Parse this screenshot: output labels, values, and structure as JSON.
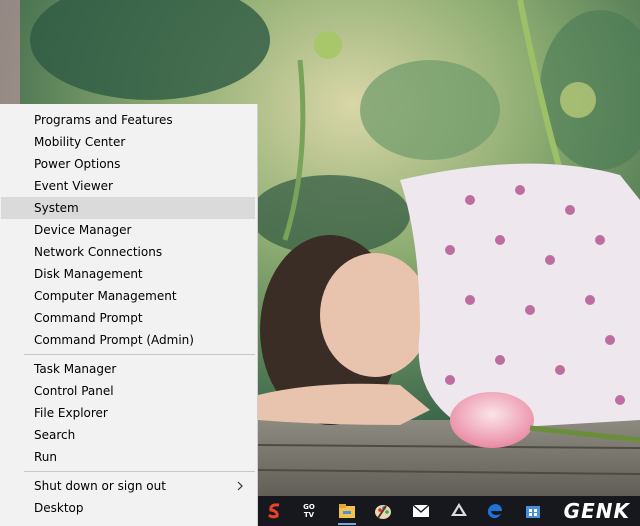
{
  "menu": {
    "items": [
      {
        "label": "Programs and Features"
      },
      {
        "label": "Mobility Center"
      },
      {
        "label": "Power Options"
      },
      {
        "label": "Event Viewer"
      },
      {
        "label": "System",
        "hovered": true
      },
      {
        "label": "Device Manager"
      },
      {
        "label": "Network Connections"
      },
      {
        "label": "Disk Management"
      },
      {
        "label": "Computer Management"
      },
      {
        "label": "Command Prompt"
      },
      {
        "label": "Command Prompt (Admin)"
      }
    ],
    "items2": [
      {
        "label": "Task Manager"
      },
      {
        "label": "Control Panel"
      },
      {
        "label": "File Explorer"
      },
      {
        "label": "Search"
      },
      {
        "label": "Run"
      }
    ],
    "items3": [
      {
        "label": "Shut down or sign out",
        "icon": "chevron-right-icon"
      },
      {
        "label": "Desktop"
      }
    ]
  },
  "taskbar": {
    "icons": [
      "app-s-icon",
      "gotv-icon",
      "file-explorer-icon",
      "paint-icon",
      "mail-icon",
      "inkscape-icon",
      "edge-icon",
      "store-icon"
    ],
    "gotv_label": "GO TV",
    "watermark": "GENK"
  },
  "colors": {
    "menu_bg": "#f2f2f2",
    "hover_bg": "#dadada",
    "taskbar_bg": "#16181d",
    "edge_blue": "#1e73d8"
  }
}
